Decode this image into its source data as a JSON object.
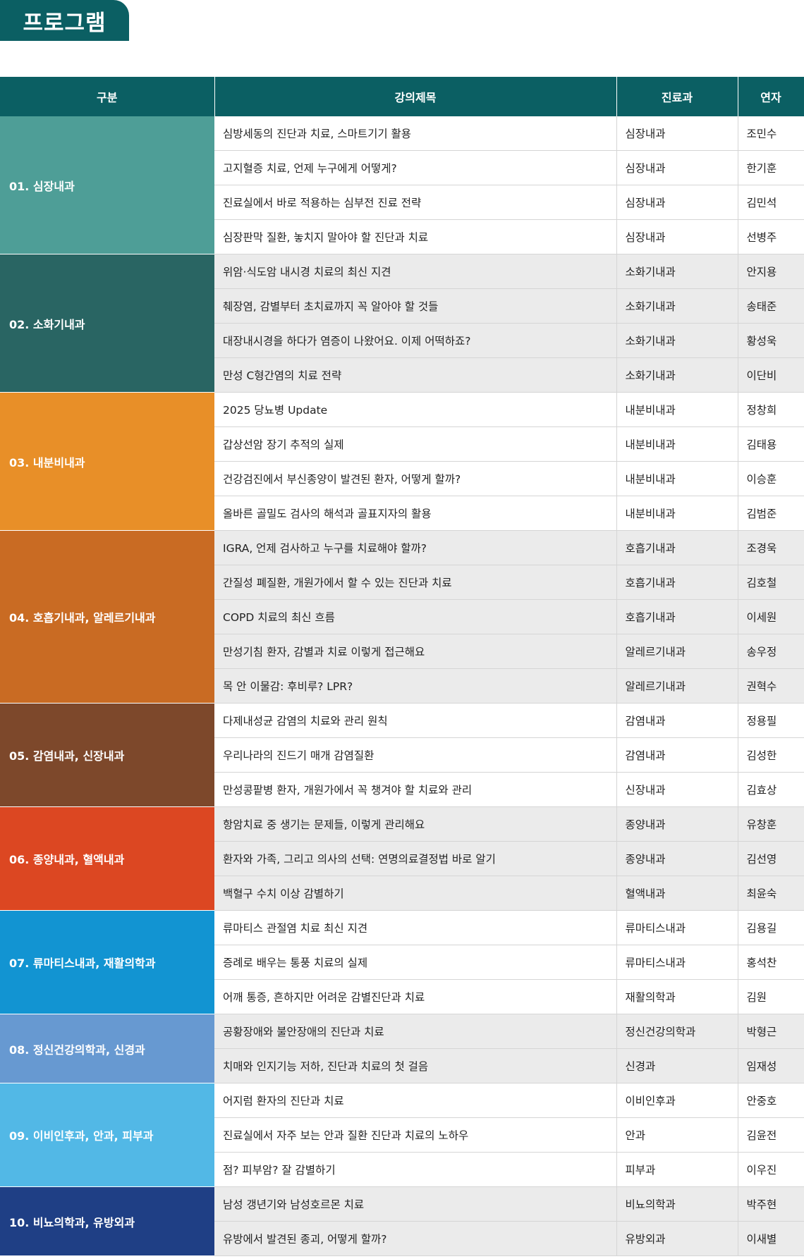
{
  "page": {
    "title": "프로그램"
  },
  "table": {
    "headers": {
      "category": "구분",
      "lecture": "강의제목",
      "department": "진료과",
      "speaker": "연자"
    },
    "groups": [
      {
        "name": "01. 심장내과",
        "color": "#4e9e97",
        "rows": [
          {
            "lecture": "심방세동의 진단과 치료, 스마트기기 활용",
            "department": "심장내과",
            "speaker": "조민수"
          },
          {
            "lecture": "고지혈증 치료, 언제 누구에게 어떻게?",
            "department": "심장내과",
            "speaker": "한기훈"
          },
          {
            "lecture": "진료실에서 바로 적용하는 심부전 진료 전략",
            "department": "심장내과",
            "speaker": "김민석"
          },
          {
            "lecture": "심장판막 질환, 놓치지 말아야 할 진단과 치료",
            "department": "심장내과",
            "speaker": "선병주"
          }
        ]
      },
      {
        "name": "02. 소화기내과",
        "color": "#296563",
        "rows": [
          {
            "lecture": "위암·식도암 내시경 치료의 최신 지견",
            "department": "소화기내과",
            "speaker": "안지용"
          },
          {
            "lecture": "췌장염, 감별부터 초치료까지 꼭 알아야 할 것들",
            "department": "소화기내과",
            "speaker": "송태준"
          },
          {
            "lecture": "대장내시경을 하다가 염증이 나왔어요. 이제 어떡하죠?",
            "department": "소화기내과",
            "speaker": "황성욱"
          },
          {
            "lecture": "만성 C형간염의 치료 전략",
            "department": "소화기내과",
            "speaker": "이단비"
          }
        ]
      },
      {
        "name": "03. 내분비내과",
        "color": "#e88f28",
        "rows": [
          {
            "lecture": "2025 당뇨병 Update",
            "department": "내분비내과",
            "speaker": "정창희"
          },
          {
            "lecture": "갑상선암 장기 추적의 실제",
            "department": "내분비내과",
            "speaker": "김태용"
          },
          {
            "lecture": "건강검진에서 부신종양이 발견된 환자, 어떻게 할까?",
            "department": "내분비내과",
            "speaker": "이승훈"
          },
          {
            "lecture": "올바른 골밀도 검사의 해석과 골표지자의 활용",
            "department": "내분비내과",
            "speaker": "김범준"
          }
        ]
      },
      {
        "name": "04. 호흡기내과, 알레르기내과",
        "color": "#c96b23",
        "rows": [
          {
            "lecture": "IGRA, 언제 검사하고 누구를 치료해야 할까?",
            "department": "호흡기내과",
            "speaker": "조경욱"
          },
          {
            "lecture": "간질성 폐질환, 개원가에서 할 수 있는 진단과 치료",
            "department": "호흡기내과",
            "speaker": "김호철"
          },
          {
            "lecture": "COPD 치료의 최신 흐름",
            "department": "호흡기내과",
            "speaker": "이세원"
          },
          {
            "lecture": "만성기침 환자, 감별과 치료 이렇게 접근해요",
            "department": "알레르기내과",
            "speaker": "송우정"
          },
          {
            "lecture": "목 안 이물감: 후비루? LPR?",
            "department": "알레르기내과",
            "speaker": "권혁수"
          }
        ]
      },
      {
        "name": "05. 감염내과, 신장내과",
        "color": "#7d482b",
        "rows": [
          {
            "lecture": "다제내성균 감염의 치료와 관리 원칙",
            "department": "감염내과",
            "speaker": "정용필"
          },
          {
            "lecture": "우리나라의 진드기 매개 감염질환",
            "department": "감염내과",
            "speaker": "김성한"
          },
          {
            "lecture": "만성콩팥병 환자, 개원가에서 꼭 챙겨야 할 치료와 관리",
            "department": "신장내과",
            "speaker": "김효상"
          }
        ]
      },
      {
        "name": "06. 종양내과, 혈액내과",
        "color": "#dc4722",
        "rows": [
          {
            "lecture": "항암치료 중 생기는 문제들, 이렇게 관리해요",
            "department": "종양내과",
            "speaker": "유창훈"
          },
          {
            "lecture": "환자와 가족, 그리고 의사의 선택: 연명의료결정법 바로 알기",
            "department": "종양내과",
            "speaker": "김선영"
          },
          {
            "lecture": "백혈구 수치 이상 감별하기",
            "department": "혈액내과",
            "speaker": "최윤숙"
          }
        ]
      },
      {
        "name": "07. 류마티스내과, 재활의학과",
        "color": "#1294d2",
        "rows": [
          {
            "lecture": "류마티스 관절염 치료 최신 지견",
            "department": "류마티스내과",
            "speaker": "김용길"
          },
          {
            "lecture": "증례로 배우는 통풍 치료의 실제",
            "department": "류마티스내과",
            "speaker": "홍석찬"
          },
          {
            "lecture": "어깨 통증, 흔하지만 어려운 감별진단과 치료",
            "department": "재활의학과",
            "speaker": "김원"
          }
        ]
      },
      {
        "name": "08. 정신건강의학과, 신경과",
        "color": "#6799d1",
        "rows": [
          {
            "lecture": "공황장애와 불안장애의 진단과 치료",
            "department": "정신건강의학과",
            "speaker": "박형근"
          },
          {
            "lecture": "치매와 인지기능 저하, 진단과 치료의 첫 걸음",
            "department": "신경과",
            "speaker": "임재성"
          }
        ]
      },
      {
        "name": "09. 이비인후과, 안과, 피부과",
        "color": "#52b8e6",
        "rows": [
          {
            "lecture": "어지럼 환자의 진단과 치료",
            "department": "이비인후과",
            "speaker": "안중호"
          },
          {
            "lecture": "진료실에서 자주 보는 안과 질환 진단과 치료의 노하우",
            "department": "안과",
            "speaker": "김윤전"
          },
          {
            "lecture": "점? 피부암? 잘 감별하기",
            "department": "피부과",
            "speaker": "이우진"
          }
        ]
      },
      {
        "name": "10. 비뇨의학과, 유방외과",
        "color": "#1f3f85",
        "rows": [
          {
            "lecture": "남성 갱년기와 남성호르몬 치료",
            "department": "비뇨의학과",
            "speaker": "박주현"
          },
          {
            "lecture": "유방에서 발견된 종괴, 어떻게 할까?",
            "department": "유방외과",
            "speaker": "이새별"
          }
        ]
      }
    ]
  }
}
